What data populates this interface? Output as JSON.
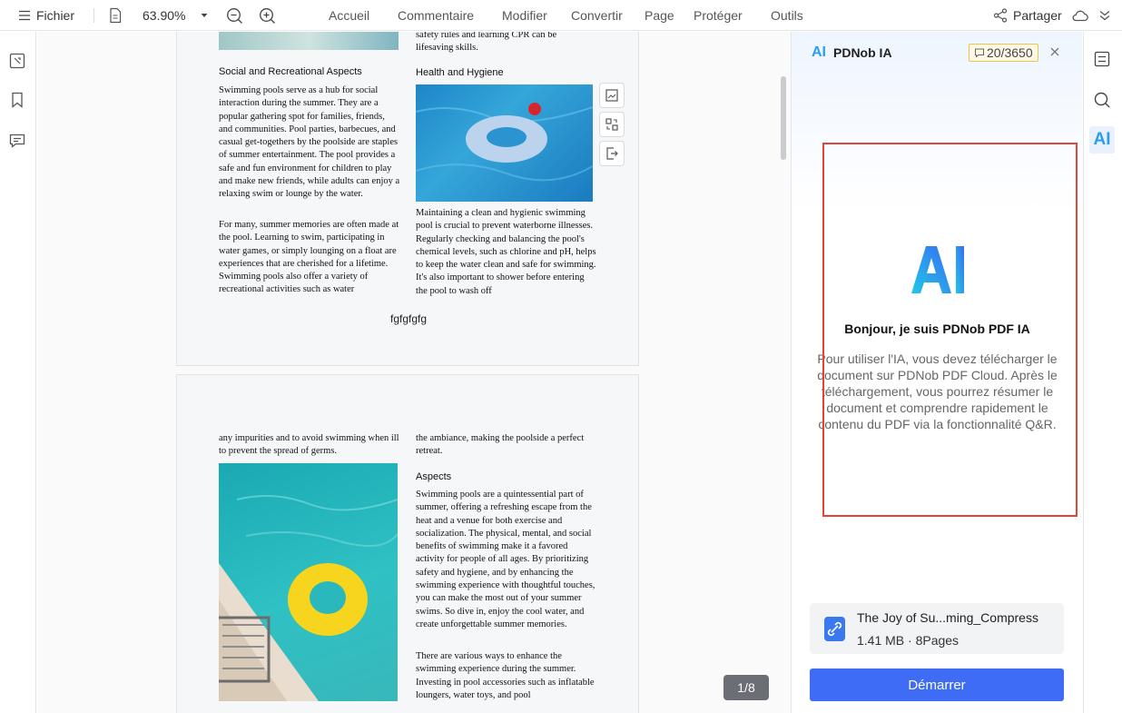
{
  "toolbar": {
    "file_label": "Fichier",
    "zoom": "63.90%",
    "menu": [
      "Accueil",
      "Commentaire",
      "Modifier",
      "Convertir",
      "Page",
      "Protéger",
      "Outils"
    ],
    "share_label": "Partager"
  },
  "doc": {
    "page1": {
      "top_right_frag": "safety rules and learning CPR can be lifesaving skills.",
      "left_heading": "Social and Recreational Aspects",
      "left_p1": "Swimming pools serve as a hub for social interaction during the summer. They are a popular gathering spot for families, friends, and communities. Pool parties, barbecues, and casual get-togethers by the poolside are staples of summer entertainment. The pool provides a safe and fun environment for children to play and make new friends, while adults can enjoy a relaxing swim or lounge by the water.",
      "left_p2": "For many, summer memories are often made at the pool. Learning to swim, participating in water games, or simply lounging on a float are experiences that are cherished for a lifetime. Swimming pools also offer a variety of recreational activities such as water",
      "right_heading": "Health and Hygiene",
      "right_p": "Maintaining a clean and hygienic swimming pool is crucial to prevent waterborne illnesses. Regularly checking and balancing the pool's chemical levels, such as chlorine and pH, helps to keep the water clean and safe for swimming. It's also important to shower before entering the pool to wash off",
      "footer_text": "fgfgfgfg"
    },
    "page2": {
      "left_top": "any impurities and to avoid swimming when ill to prevent the spread of germs.",
      "right_top": "the ambiance, making the poolside a perfect retreat.",
      "right_heading": "Aspects",
      "right_p1": "Swimming pools are a quintessential part of summer, offering a refreshing escape from the heat and a venue for both exercise and socialization. The physical, mental, and social benefits of swimming make it a favored activity for people of all ages. By prioritizing safety and hygiene, and by enhancing the swimming experience with thoughtful touches, you can make the most out of your summer swims. So dive in, enjoy the cool water, and create unforgettable summer memories.",
      "right_p2": "There are various ways to enhance the swimming experience during the summer. Investing in pool accessories such as inflatable loungers, water toys, and pool"
    },
    "page_indicator": "1/8"
  },
  "ai_panel": {
    "title": "PDNob IA",
    "quota": "20/3650",
    "logo_text": "AI",
    "greeting": "Bonjour, je suis PDNob PDF IA",
    "description": "Pour utiliser l'IA, vous devez télécharger le document sur PDNob PDF Cloud. Après le téléchargement, vous pourrez résumer le document et comprendre rapidement le contenu du PDF via la fonctionnalité Q&R.",
    "file_name": "The Joy of Su...ming_Compress",
    "file_meta": "1.41 MB · 8Pages",
    "start_label": "Démarrer"
  },
  "rail": {
    "ai_label": "AI"
  },
  "colors": {
    "accent": "#3f6cf4",
    "highlight_frame": "#e0453a",
    "page_badge": "#6b6e74"
  }
}
